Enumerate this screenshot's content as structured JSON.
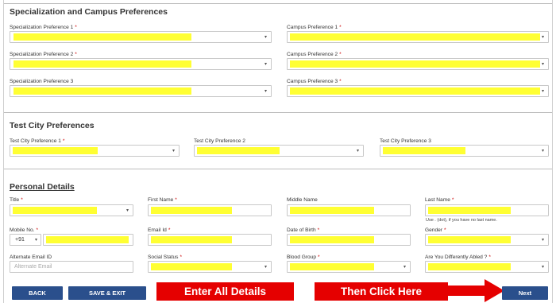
{
  "sections": {
    "specialization": "Specialization and Campus Preferences",
    "test_city": "Test City Preferences",
    "personal": "Personal Details"
  },
  "required_mark": "*",
  "specialization": {
    "spec1": "Specialization Preference 1",
    "spec2": "Specialization Preference 2",
    "spec3": "Specialization Preference 3",
    "campus1": "Campus Preference 1",
    "campus2": "Campus Preference 2",
    "campus3": "Campus Preference 3"
  },
  "test_city": {
    "city1": "Test City Preference 1",
    "city2": "Test City Preference 2",
    "city3": "Test City Preference 3"
  },
  "personal": {
    "title": "Title",
    "first_name": "First Name",
    "middle_name": "Middle Name",
    "last_name": "Last Name",
    "last_name_hint": "Use . (dot), if you have no last name.",
    "mobile": "Mobile No.",
    "country_code": "+91",
    "email": "Email Id",
    "dob": "Date of Birth",
    "gender": "Gender",
    "alt_email": "Alternate Email ID",
    "alt_email_placeholder": "Alternate Email",
    "social_status": "Social Status",
    "blood_group": "Blood Group",
    "differently_abled": "Are You Differently Abled ?"
  },
  "buttons": {
    "back": "BACK",
    "save_exit": "SAVE & EXIT",
    "next": "Next"
  },
  "annotations": {
    "enter_all": "Enter All Details",
    "then_click": "Then Click Here"
  },
  "icons": {
    "caret": "▾",
    "arrow": "arrow-right-icon"
  },
  "colors": {
    "highlight": "#ffff33",
    "button": "#2a4f8c",
    "banner": "#e50000",
    "required": "#cc0000"
  }
}
